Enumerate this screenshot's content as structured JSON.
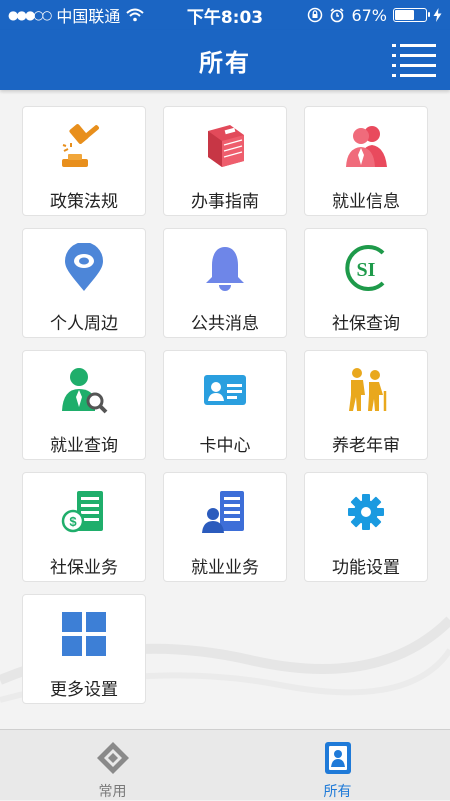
{
  "status": {
    "signal_dots": "●●●○○",
    "carrier": "中国联通",
    "time": "下午8:03",
    "battery_pct": "67%",
    "battery_level": 0.67
  },
  "header": {
    "title": "所有"
  },
  "grid": {
    "items": [
      {
        "label": "政策法规",
        "icon": "gavel-icon"
      },
      {
        "label": "办事指南",
        "icon": "book-icon"
      },
      {
        "label": "就业信息",
        "icon": "people-icon"
      },
      {
        "label": "个人周边",
        "icon": "location-pin-icon"
      },
      {
        "label": "公共消息",
        "icon": "bell-icon"
      },
      {
        "label": "社保查询",
        "icon": "si-logo-icon"
      },
      {
        "label": "就业查询",
        "icon": "person-search-icon"
      },
      {
        "label": "卡中心",
        "icon": "id-card-icon"
      },
      {
        "label": "养老年审",
        "icon": "elderly-icon"
      },
      {
        "label": "社保业务",
        "icon": "money-doc-icon"
      },
      {
        "label": "就业业务",
        "icon": "person-doc-icon"
      },
      {
        "label": "功能设置",
        "icon": "gear-icon"
      },
      {
        "label": "更多设置",
        "icon": "grid-icon"
      }
    ]
  },
  "tabbar": {
    "tabs": [
      {
        "label": "常用",
        "icon": "diamond-icon",
        "active": false
      },
      {
        "label": "所有",
        "icon": "contact-card-icon",
        "active": true
      }
    ]
  },
  "colors": {
    "brand_blue": "#1b65c3",
    "tab_active": "#1f7ad8",
    "tab_inactive": "#7a7a7a"
  }
}
